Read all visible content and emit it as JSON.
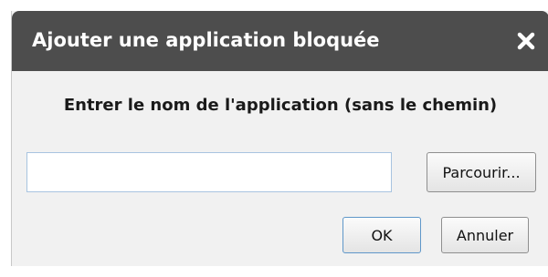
{
  "dialog": {
    "title": "Ajouter une application bloquée",
    "close_icon": "close-icon",
    "instruction": "Entrer le nom de l'application (sans le chemin)",
    "input": {
      "value": "",
      "placeholder": ""
    },
    "browse_label": "Parcourir...",
    "ok_label": "OK",
    "cancel_label": "Annuler"
  },
  "colors": {
    "titlebar": "#4d4d4d",
    "body": "#f1f1f1",
    "title_text": "#ffffff",
    "input_border": "#a8c4e0",
    "default_button_border": "#5f97c9"
  }
}
